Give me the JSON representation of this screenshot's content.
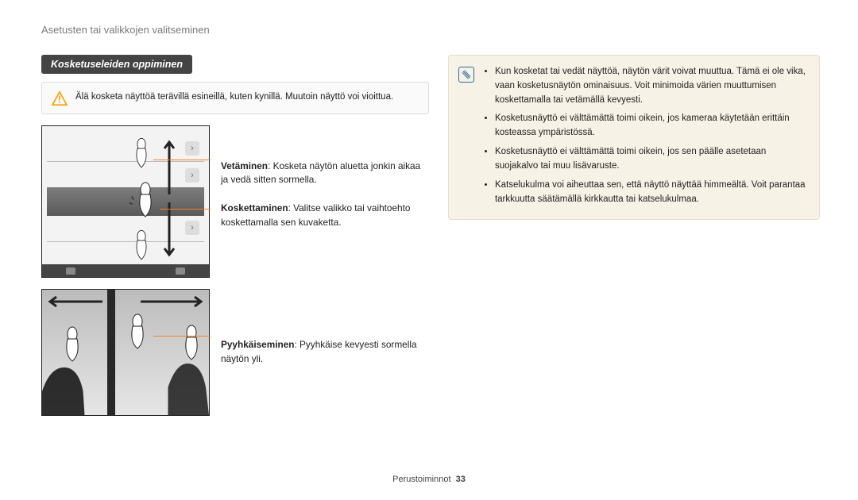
{
  "header": "Asetusten tai valikkojen valitseminen",
  "pill": "Kosketuseleiden oppiminen",
  "warning": "Älä kosketa näyttöä terävillä esineillä, kuten kynillä. Muutoin näyttö voi vioittua.",
  "gestures": {
    "drag_label": "Vetäminen",
    "drag_text": ": Kosketa näytön aluetta jonkin aikaa ja vedä sitten sormella.",
    "tap_label": "Koskettaminen",
    "tap_text": ": Valitse valikko tai vaihtoehto koskettamalla sen kuvaketta.",
    "swipe_label": "Pyyhkäiseminen",
    "swipe_text": ": Pyyhkäise kevyesti sormella näytön yli."
  },
  "notes": {
    "n1": "Kun kosketat tai vedät näyttöä, näytön värit voivat muuttua. Tämä ei ole vika, vaan kosketusnäytön ominaisuus. Voit minimoida värien muuttumisen koskettamalla tai vetämällä kevyesti.",
    "n2": "Kosketusnäyttö ei välttämättä toimi oikein, jos kameraa käytetään erittäin kosteassa ympäristössä.",
    "n3": "Kosketusnäyttö ei välttämättä toimi oikein, jos sen päälle asetetaan suojakalvo tai muu lisävaruste.",
    "n4": "Katselukulma voi aiheuttaa sen, että näyttö näyttää himmeältä. Voit parantaa tarkkuutta säätämällä kirkkautta tai katselukulmaa."
  },
  "footer_label": "Perustoiminnot",
  "footer_page": "33",
  "glyphs": {
    "chev_right": "›"
  }
}
